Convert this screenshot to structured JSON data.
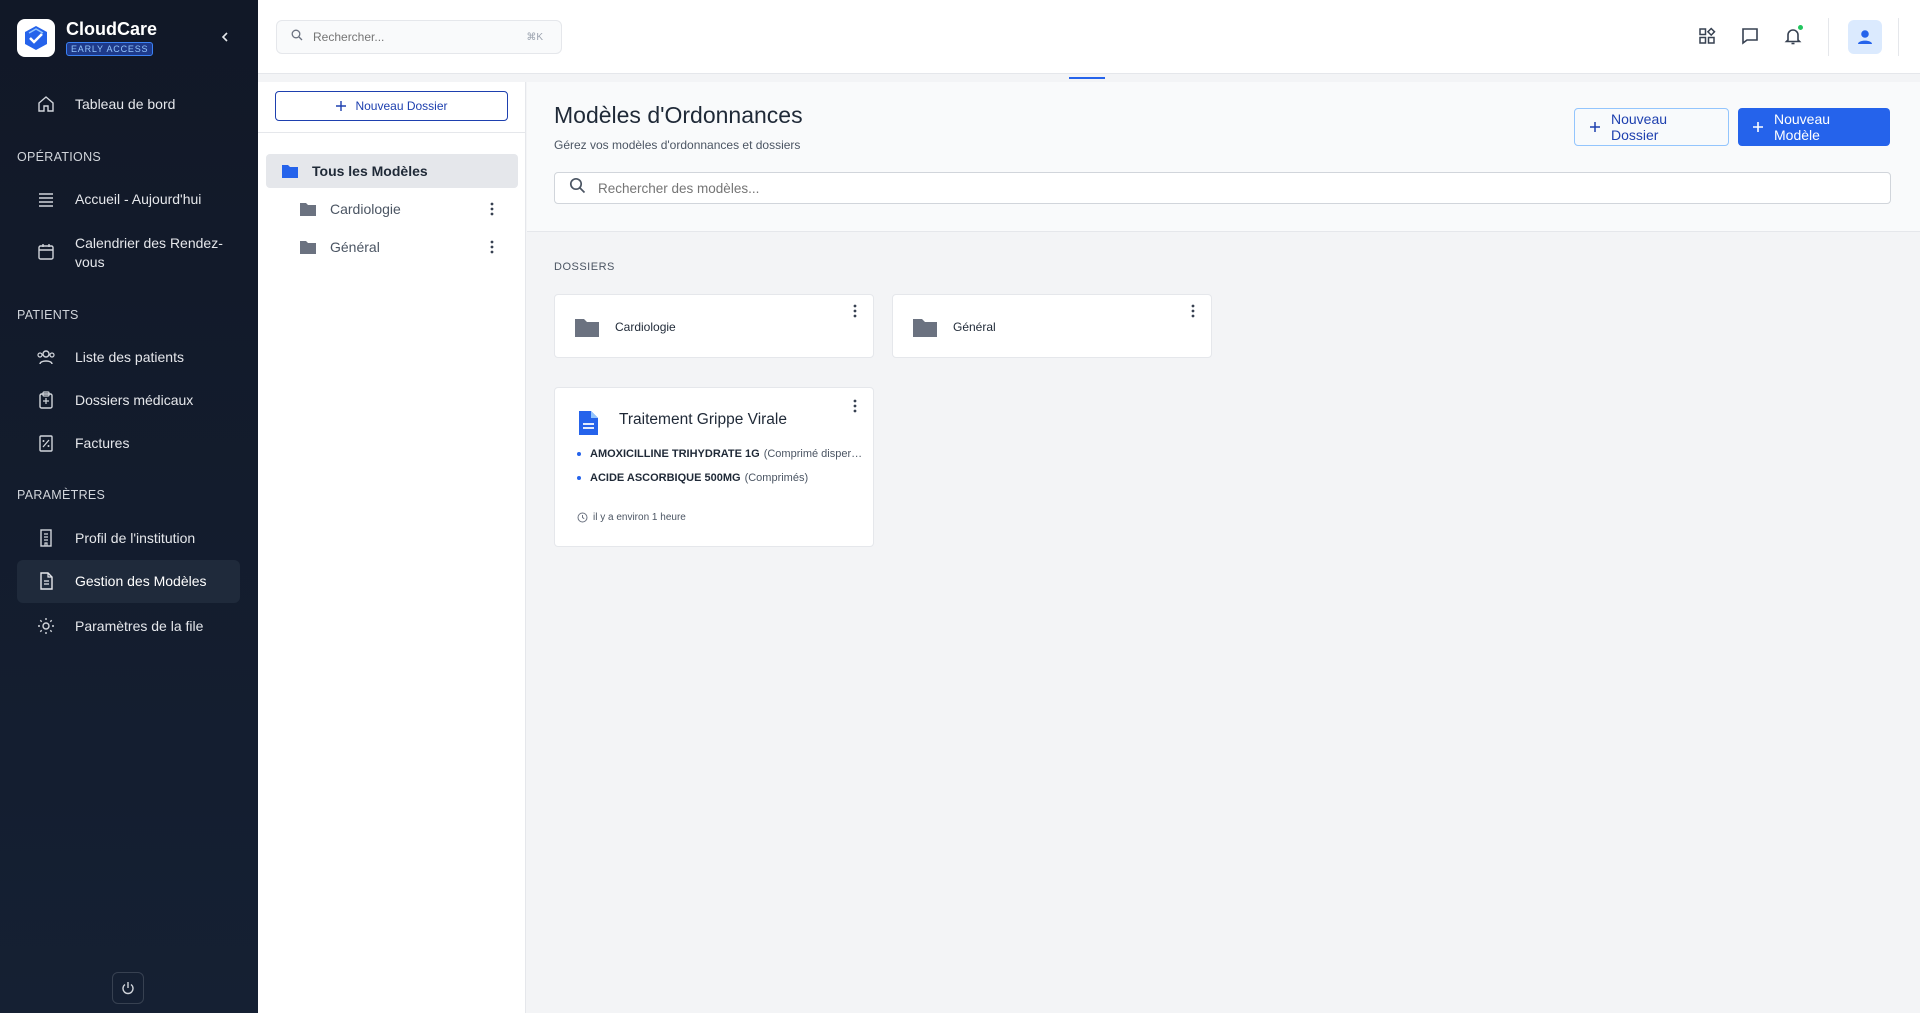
{
  "brand": {
    "name": "CloudCare",
    "badge": "EARLY ACCESS"
  },
  "sidebar": {
    "items": [
      {
        "label": "Tableau de bord",
        "icon": "home-icon"
      },
      {
        "label": "Accueil - Aujourd'hui",
        "icon": "list-icon"
      },
      {
        "label": "Calendrier des Rendez-vous",
        "icon": "calendar-icon"
      },
      {
        "label": "Liste des patients",
        "icon": "users-icon"
      },
      {
        "label": "Dossiers médicaux",
        "icon": "clipboard-icon"
      },
      {
        "label": "Factures",
        "icon": "invoice-icon"
      },
      {
        "label": "Profil de l'institution",
        "icon": "building-icon"
      },
      {
        "label": "Gestion des Modèles",
        "icon": "document-icon",
        "active": true
      },
      {
        "label": "Paramètres de la file",
        "icon": "gear-icon"
      }
    ],
    "sections": {
      "operations": "OPÉRATIONS",
      "patients": "PATIENTS",
      "settings": "PARAMÈTRES"
    }
  },
  "topbar": {
    "search_placeholder": "Rechercher...",
    "search_shortcut": "⌘K",
    "notification_dot_color": "#22c55e"
  },
  "folder_panel": {
    "new_folder_label": "Nouveau Dossier",
    "tree": [
      {
        "label": "Tous les Modèles",
        "selected": true
      },
      {
        "label": "Cardiologie"
      },
      {
        "label": "Général"
      }
    ]
  },
  "main": {
    "title": "Modèles d'Ordonnances",
    "subtitle": "Gérez vos modèles d'ordonnances et dossiers",
    "new_folder_label": "Nouveau Dossier",
    "new_model_label": "Nouveau Modèle",
    "search_placeholder": "Rechercher des modèles...",
    "folders_section": "DOSSIERS",
    "folders": [
      {
        "label": "Cardiologie"
      },
      {
        "label": "Général"
      }
    ],
    "models": [
      {
        "title": "Traitement Grippe Virale",
        "medications": [
          {
            "name": "AMOXICILLINE TRIHYDRATE 1G",
            "form": "(Comprimé dispersible)"
          },
          {
            "name": "ACIDE ASCORBIQUE 500MG",
            "form": "(Comprimés)"
          }
        ],
        "updated": "il y a environ 1 heure"
      }
    ]
  },
  "colors": {
    "accent": "#2563eb",
    "sidebar_bg": "#111827",
    "folder_icon": "#6b7280"
  }
}
